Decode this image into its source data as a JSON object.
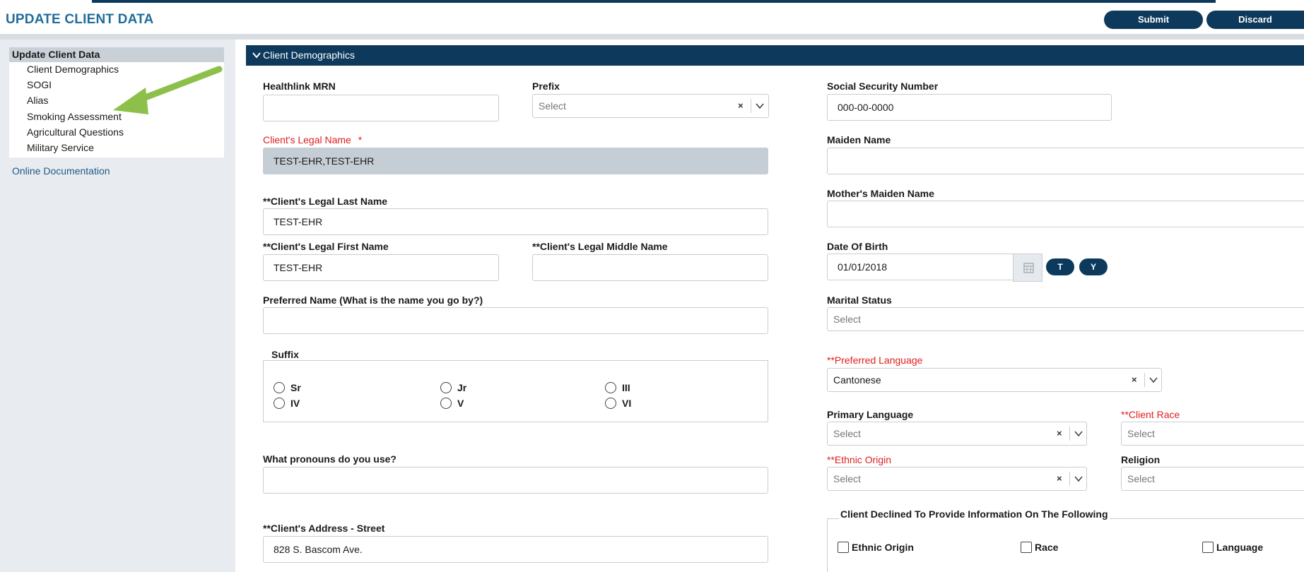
{
  "app": {
    "title": "UPDATE CLIENT DATA",
    "submit_label": "Submit",
    "discard_label": "Discard"
  },
  "sidebar": {
    "header": "Update Client Data",
    "items": [
      {
        "label": "Client Demographics"
      },
      {
        "label": "SOGI"
      },
      {
        "label": "Alias"
      },
      {
        "label": "Smoking Assessment"
      },
      {
        "label": "Agricultural Questions"
      },
      {
        "label": "Military Service"
      }
    ],
    "online_doc": "Online Documentation",
    "arrow_color": "#8cc04b"
  },
  "section": {
    "title": "Client Demographics"
  },
  "form": {
    "healthlink_mrn": {
      "label": "Healthlink MRN",
      "value": ""
    },
    "prefix": {
      "label": "Prefix",
      "placeholder": "Select"
    },
    "legal_name": {
      "label": "Client's Legal Name",
      "required_mark": "*",
      "value": "TEST-EHR,TEST-EHR"
    },
    "last_name": {
      "label": "**Client's Legal Last Name",
      "value": "TEST-EHR"
    },
    "first_name": {
      "label": "**Client's Legal First Name",
      "value": "TEST-EHR"
    },
    "middle_name": {
      "label": "**Client's Legal Middle Name",
      "value": ""
    },
    "preferred_name": {
      "label": "Preferred Name (What is the name you go by?)",
      "value": ""
    },
    "suffix": {
      "label": "Suffix",
      "options": [
        "Sr",
        "Jr",
        "III",
        "IV",
        "V",
        "VI"
      ]
    },
    "pronouns": {
      "label": "What pronouns do you use?",
      "value": ""
    },
    "address_street": {
      "label": "**Client's Address - Street",
      "value": "828 S. Bascom Ave."
    },
    "ssn": {
      "label": "Social Security Number",
      "value": "000-00-0000"
    },
    "maiden_name": {
      "label": "Maiden Name",
      "value": ""
    },
    "mothers_maiden_name": {
      "label": "Mother's Maiden Name",
      "value": ""
    },
    "dob": {
      "label": "Date Of Birth",
      "value": "01/01/2018",
      "today_btn": "T",
      "yesterday_btn": "Y"
    },
    "marital_status": {
      "label": "Marital Status",
      "placeholder": "Select"
    },
    "preferred_language": {
      "label": "**Preferred Language",
      "value": "Cantonese"
    },
    "primary_language": {
      "label": "Primary Language",
      "placeholder": "Select"
    },
    "client_race": {
      "label": "**Client Race",
      "placeholder": "Select"
    },
    "ethnic_origin": {
      "label": "**Ethnic Origin",
      "placeholder": "Select"
    },
    "religion": {
      "label": "Religion",
      "placeholder": "Select"
    },
    "declined": {
      "label": "Client Declined To Provide Information On The Following",
      "options": [
        "Ethnic Origin",
        "Race",
        "Language"
      ]
    },
    "clear_glyph": "×"
  }
}
